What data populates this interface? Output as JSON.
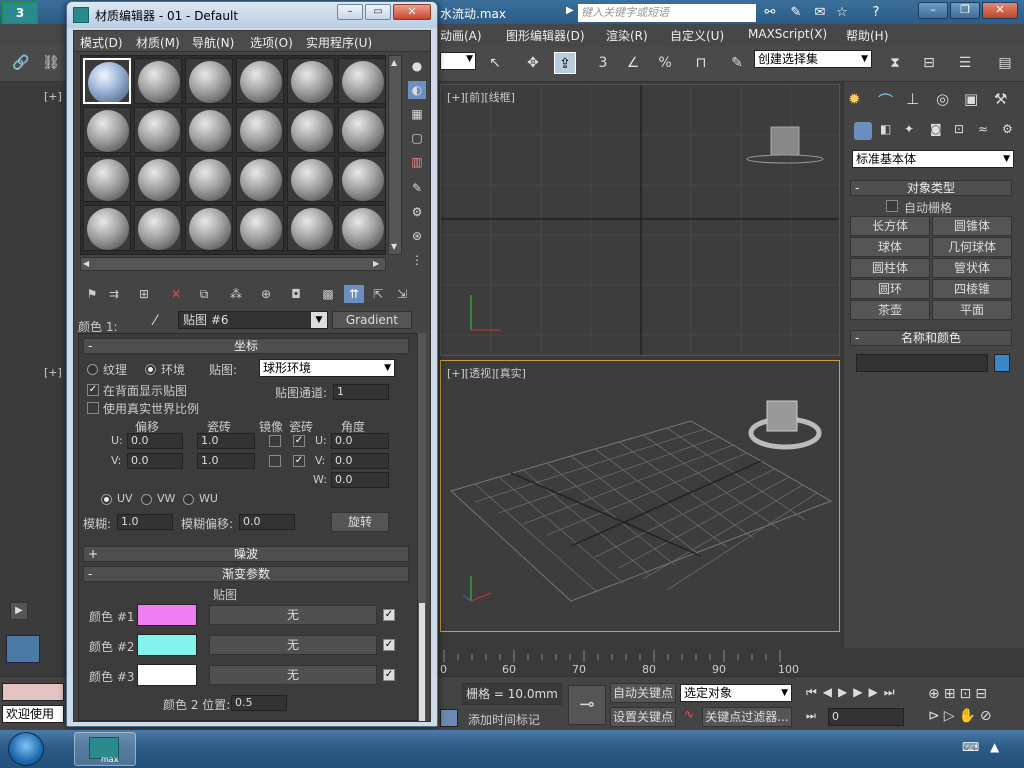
{
  "max": {
    "title_fragment": "水流动.max",
    "search_placeholder": "键入关键字或短语",
    "menu": [
      "动画(A)",
      "图形编辑器(D)",
      "渲染(R)",
      "自定义(U)",
      "MAXScript(X)",
      "帮助(H)"
    ],
    "selection_set": "创建选择集",
    "viewports": {
      "front_label": "[+][前][线框]",
      "persp_label": "[+][透视][真实]",
      "left_tl": "[+]",
      "left_bl": "[+]"
    },
    "command_panel": {
      "dropdown": "标准基本体",
      "object_type": "对象类型",
      "auto_grid": "自动栅格",
      "buttons": [
        "长方体",
        "圆锥体",
        "球体",
        "几何球体",
        "圆柱体",
        "管状体",
        "圆环",
        "四棱锥",
        "茶壶",
        "平面"
      ],
      "name_color": "名称和颜色"
    },
    "timeline": {
      "ticks": [
        "0",
        "60",
        "70",
        "80",
        "90",
        "100"
      ]
    },
    "status": {
      "welcome": "欢迎使用",
      "grid": "栅格 = 10.0mm",
      "add_time_tag": "添加时间标记",
      "auto_key": "自动关键点",
      "set_key": "设置关键点",
      "selected_object": "选定对象",
      "key_filters": "关键点过滤器...",
      "frame_value": "0"
    }
  },
  "material_editor": {
    "title": "材质编辑器 - 01 - Default",
    "menu": [
      "模式(D)",
      "材质(M)",
      "导航(N)",
      "选项(O)",
      "实用程序(U)"
    ],
    "color_label": "颜色 1:",
    "map_name": "贴图 #6",
    "map_type": "Gradient",
    "coordinates": {
      "header": "坐标",
      "texture": "纹理",
      "environment": "环境",
      "mapping_label": "贴图:",
      "mapping_value": "球形环境",
      "show_map_back": "在背面显示贴图",
      "map_channel_label": "贴图通道:",
      "map_channel_value": "1",
      "real_world": "使用真实世界比例",
      "col_offset": "偏移",
      "col_tiling": "瓷砖",
      "col_mirror": "镜像",
      "col_tile": "瓷砖",
      "col_angle": "角度",
      "u_label": "U:",
      "v_label": "V:",
      "w_label": "W:",
      "u_offset": "0.0",
      "v_offset": "0.0",
      "u_tiling": "1.0",
      "v_tiling": "1.0",
      "u_angle": "0.0",
      "v_angle": "0.0",
      "w_angle": "0.0",
      "uv": "UV",
      "vw": "VW",
      "wu": "WU",
      "blur_label": "模糊:",
      "blur_value": "1.0",
      "blur_offset_label": "模糊偏移:",
      "blur_offset_value": "0.0",
      "rotate": "旋转"
    },
    "noise_header": "噪波",
    "gradient": {
      "header": "渐变参数",
      "maps_label": "贴图",
      "color1_label": "颜色 #1",
      "color2_label": "颜色 #2",
      "color3_label": "颜色 #3",
      "color1": "#f07ef2",
      "color2": "#84f3ee",
      "color3": "#ffffff",
      "none": "无",
      "pos_label": "颜色 2 位置:",
      "pos_value": "0.5"
    }
  },
  "taskbar": {
    "app_label": "max"
  }
}
